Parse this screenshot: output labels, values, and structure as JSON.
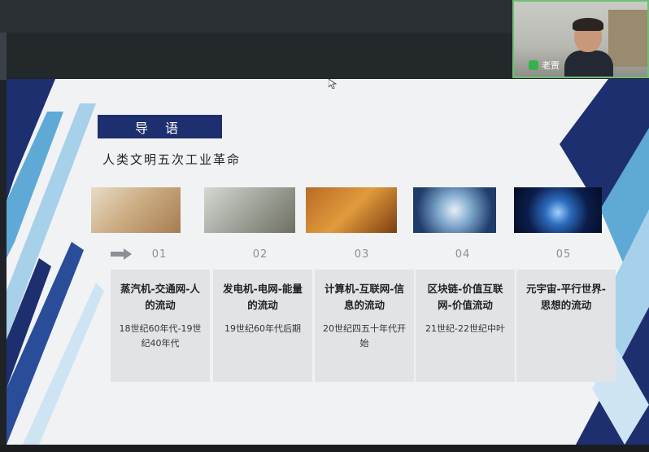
{
  "video": {
    "participant_name": "老贾"
  },
  "slide": {
    "heading": "导 语",
    "subtitle": "人类文明五次工业革命",
    "items": [
      {
        "num": "01",
        "title": "蒸汽机-交通网-人的流动",
        "period": "18世纪60年代-19世纪40年代"
      },
      {
        "num": "02",
        "title": "发电机-电网-能量的流动",
        "period": "19世纪60年代后期"
      },
      {
        "num": "03",
        "title": "计算机-互联网-信息的流动",
        "period": "20世纪四五十年代开始"
      },
      {
        "num": "04",
        "title": "区块链-价值互联网-价值流动",
        "period": "21世纪-22世纪中叶"
      },
      {
        "num": "05",
        "title": "元宇宙-平行世界-思想的流动",
        "period": ""
      }
    ]
  },
  "colors": {
    "accent_navy": "#1e2f6f",
    "mic_green": "#36b24a"
  }
}
